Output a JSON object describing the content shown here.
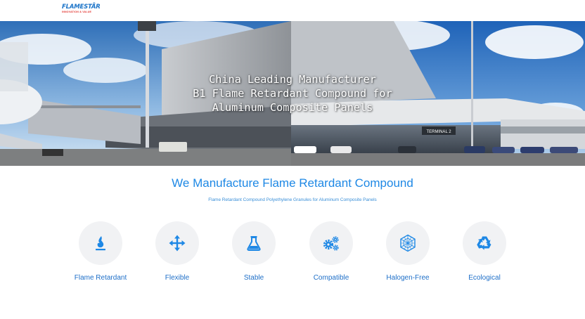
{
  "brand": {
    "name": "FLAMESTAR",
    "registered": "®",
    "tagline": "INNOVATION & VALUE"
  },
  "hero": {
    "title_lines": [
      "China Leading Manufacturer",
      "B1 Flame Retardant Compound for",
      "Aluminum Composite Panels"
    ],
    "terminal_sign": "TERMINAL 2"
  },
  "section": {
    "title": "We Manufacture Flame Retardant Compound",
    "subtitle": "Flame Retardant Compound Polyethylene Granules for Aluminum Composite Panels"
  },
  "features": [
    {
      "label": "Flame Retardant",
      "icon": "flame-icon"
    },
    {
      "label": "Flexible",
      "icon": "move-arrows-icon"
    },
    {
      "label": "Stable",
      "icon": "flask-icon"
    },
    {
      "label": "Compatible",
      "icon": "gears-icon"
    },
    {
      "label": "Halogen-Free",
      "icon": "hexagon-mesh-icon"
    },
    {
      "label": "Ecological",
      "icon": "recycle-icon"
    }
  ],
  "colors": {
    "accent": "#1e88e5",
    "icon": "#1e88e5",
    "circle_bg": "#f1f2f4"
  }
}
